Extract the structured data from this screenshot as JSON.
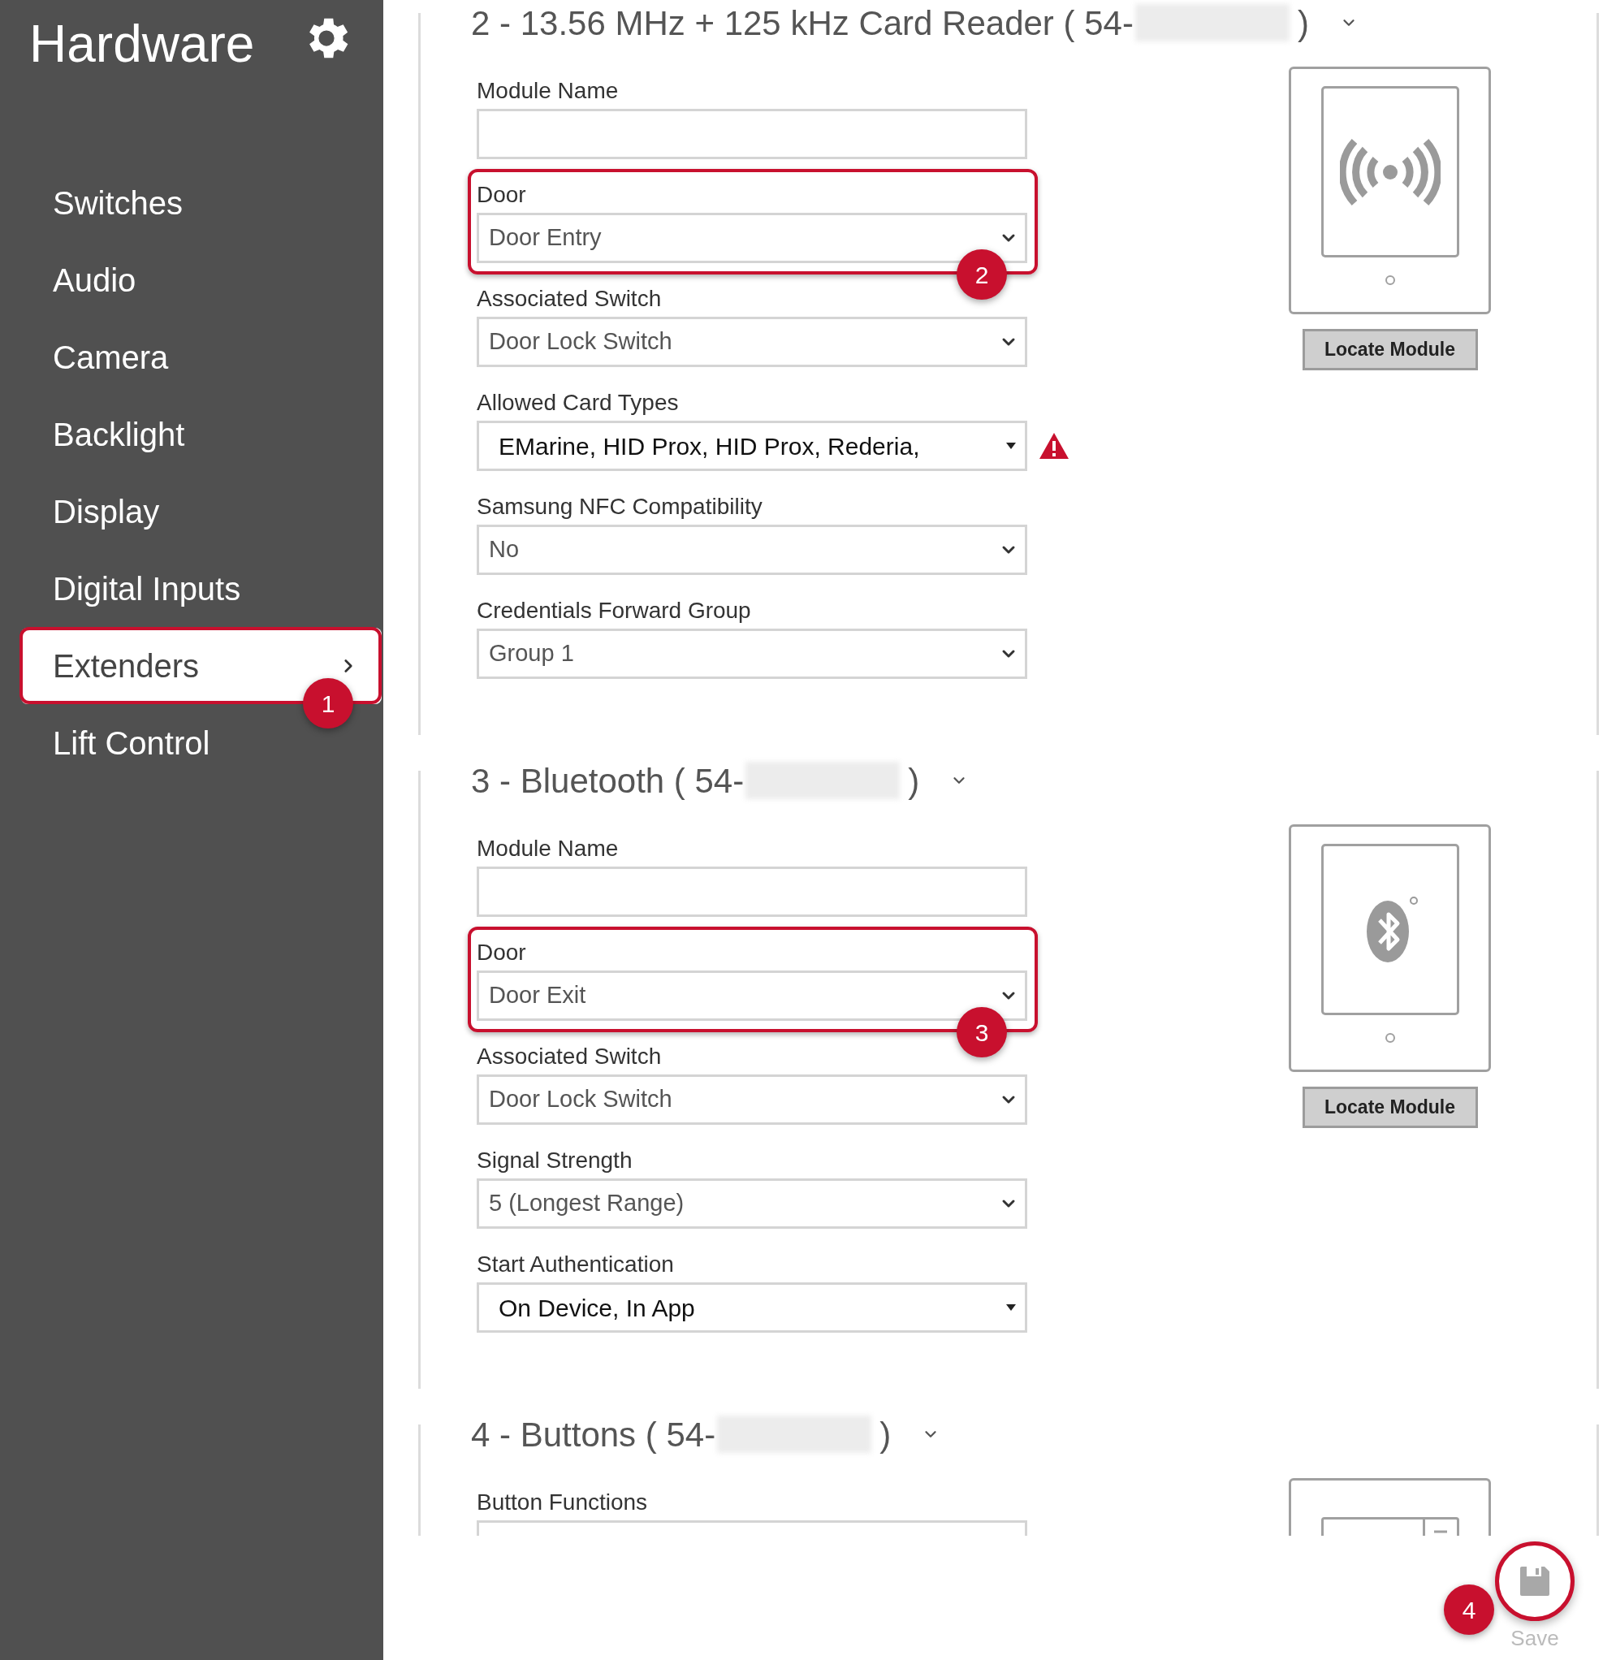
{
  "sidebar": {
    "title": "Hardware",
    "items": [
      {
        "label": "Switches",
        "selected": false
      },
      {
        "label": "Audio",
        "selected": false
      },
      {
        "label": "Camera",
        "selected": false
      },
      {
        "label": "Backlight",
        "selected": false
      },
      {
        "label": "Display",
        "selected": false
      },
      {
        "label": "Digital Inputs",
        "selected": false
      },
      {
        "label": "Extenders",
        "selected": true,
        "callout": "1"
      },
      {
        "label": "Lift Control",
        "selected": false
      }
    ]
  },
  "modules": [
    {
      "kind": "card-reader",
      "title": "2 - 13.56 MHz + 125 kHz Card Reader ( 54-",
      "title_end": ")",
      "button": "Locate Module",
      "fields": [
        {
          "label": "Module Name",
          "kind": "text"
        },
        {
          "label": "Door",
          "kind": "select",
          "value": "Door Entry",
          "callout": "2"
        },
        {
          "label": "Associated Switch",
          "kind": "select",
          "value": "Door Lock Switch"
        },
        {
          "label": "Allowed Card Types",
          "kind": "multiselect",
          "value": "EMarine, HID Prox, HID Prox, Rederia,",
          "warning": true
        },
        {
          "label": "Samsung NFC Compatibility",
          "kind": "select",
          "value": "No"
        },
        {
          "label": "Credentials Forward Group",
          "kind": "select",
          "value": "Group 1"
        }
      ]
    },
    {
      "kind": "bluetooth",
      "title": "3 - Bluetooth ( 54-",
      "title_end": ")",
      "button": "Locate Module",
      "fields": [
        {
          "label": "Module Name",
          "kind": "text"
        },
        {
          "label": "Door",
          "kind": "select",
          "value": "Door Exit",
          "callout": "3"
        },
        {
          "label": "Associated Switch",
          "kind": "select",
          "value": "Door Lock Switch"
        },
        {
          "label": "Signal Strength",
          "kind": "select",
          "value": "5 (Longest Range)"
        },
        {
          "label": "Start Authentication",
          "kind": "multiselect",
          "value": "On Device, In App"
        }
      ]
    },
    {
      "kind": "buttons",
      "title": "4 - Buttons ( 54-",
      "title_end": ")",
      "fields": [
        {
          "label": "Button Functions",
          "kind": "text"
        }
      ]
    }
  ],
  "save": {
    "label": "Save",
    "callout": "4"
  }
}
